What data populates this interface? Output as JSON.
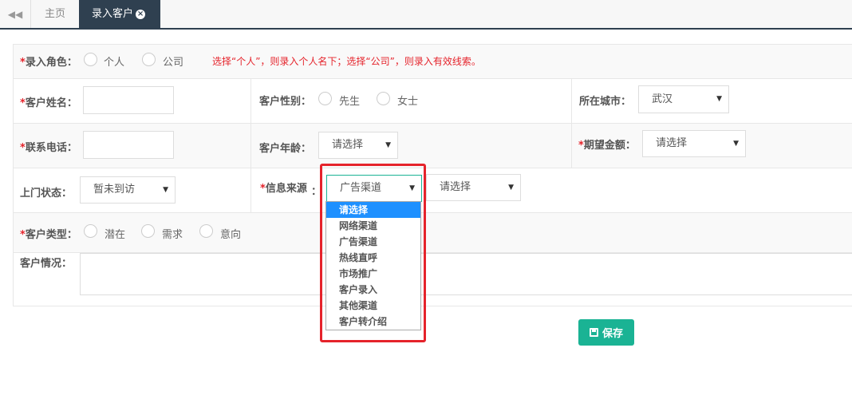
{
  "tabs": {
    "home": "主页",
    "active": "录入客户",
    "close_glyph": "×"
  },
  "form": {
    "role": {
      "label": "录入角色：",
      "options": [
        "个人",
        "公司"
      ],
      "hint": "选择“个人”，则录入个人名下；选择“公司”，则录入有效线索。"
    },
    "name": {
      "label": "客户姓名：",
      "value": ""
    },
    "gender": {
      "label": "客户性别：",
      "options": [
        "先生",
        "女士"
      ]
    },
    "city": {
      "label": "所在城市：",
      "value": "武汉"
    },
    "phone": {
      "label": "联系电话：",
      "value": ""
    },
    "age": {
      "label": "客户年龄：",
      "value": "请选择"
    },
    "amount": {
      "label": "期望金额：",
      "value": "请选择"
    },
    "visit": {
      "label": "上门状态：",
      "value": "暂未到访"
    },
    "source": {
      "label": "信息来源",
      "colon": "：",
      "value": "广告渠道",
      "sub_value": "请选择",
      "dropdown_options": [
        "请选择",
        "网络渠道",
        "广告渠道",
        "热线直呼",
        "市场推广",
        "客户录入",
        "其他渠道",
        "客户转介绍"
      ],
      "highlighted_option": "请选择"
    },
    "type": {
      "label": "客户类型：",
      "options": [
        "潜在",
        "需求",
        "意向"
      ]
    },
    "situation": {
      "label": "客户情况：",
      "value": ""
    },
    "required_mark": "*"
  },
  "save_button": {
    "label": "保存",
    "icon": "save-icon"
  },
  "colors": {
    "nav_dark": "#2f4050",
    "required_red": "#e5232b",
    "save_green": "#1ab394",
    "selected_blue": "#1e90ff"
  }
}
